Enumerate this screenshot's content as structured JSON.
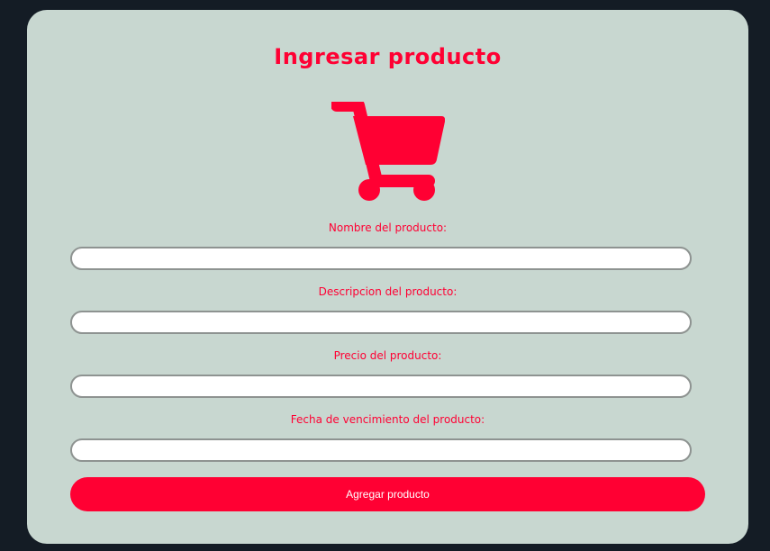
{
  "form": {
    "title": "Ingresar producto",
    "icon": "shopping-cart-icon",
    "accent_color": "#ff0033",
    "card_color": "#c8d7d0",
    "background_color": "#141c25",
    "fields": [
      {
        "label": "Nombre del producto:",
        "value": "",
        "placeholder": ""
      },
      {
        "label": "Descripcion del producto:",
        "value": "",
        "placeholder": ""
      },
      {
        "label": "Precio del producto:",
        "value": "",
        "placeholder": ""
      },
      {
        "label": "Fecha de vencimiento del producto:",
        "value": "",
        "placeholder": ""
      }
    ],
    "submit_label": "Agregar producto"
  }
}
